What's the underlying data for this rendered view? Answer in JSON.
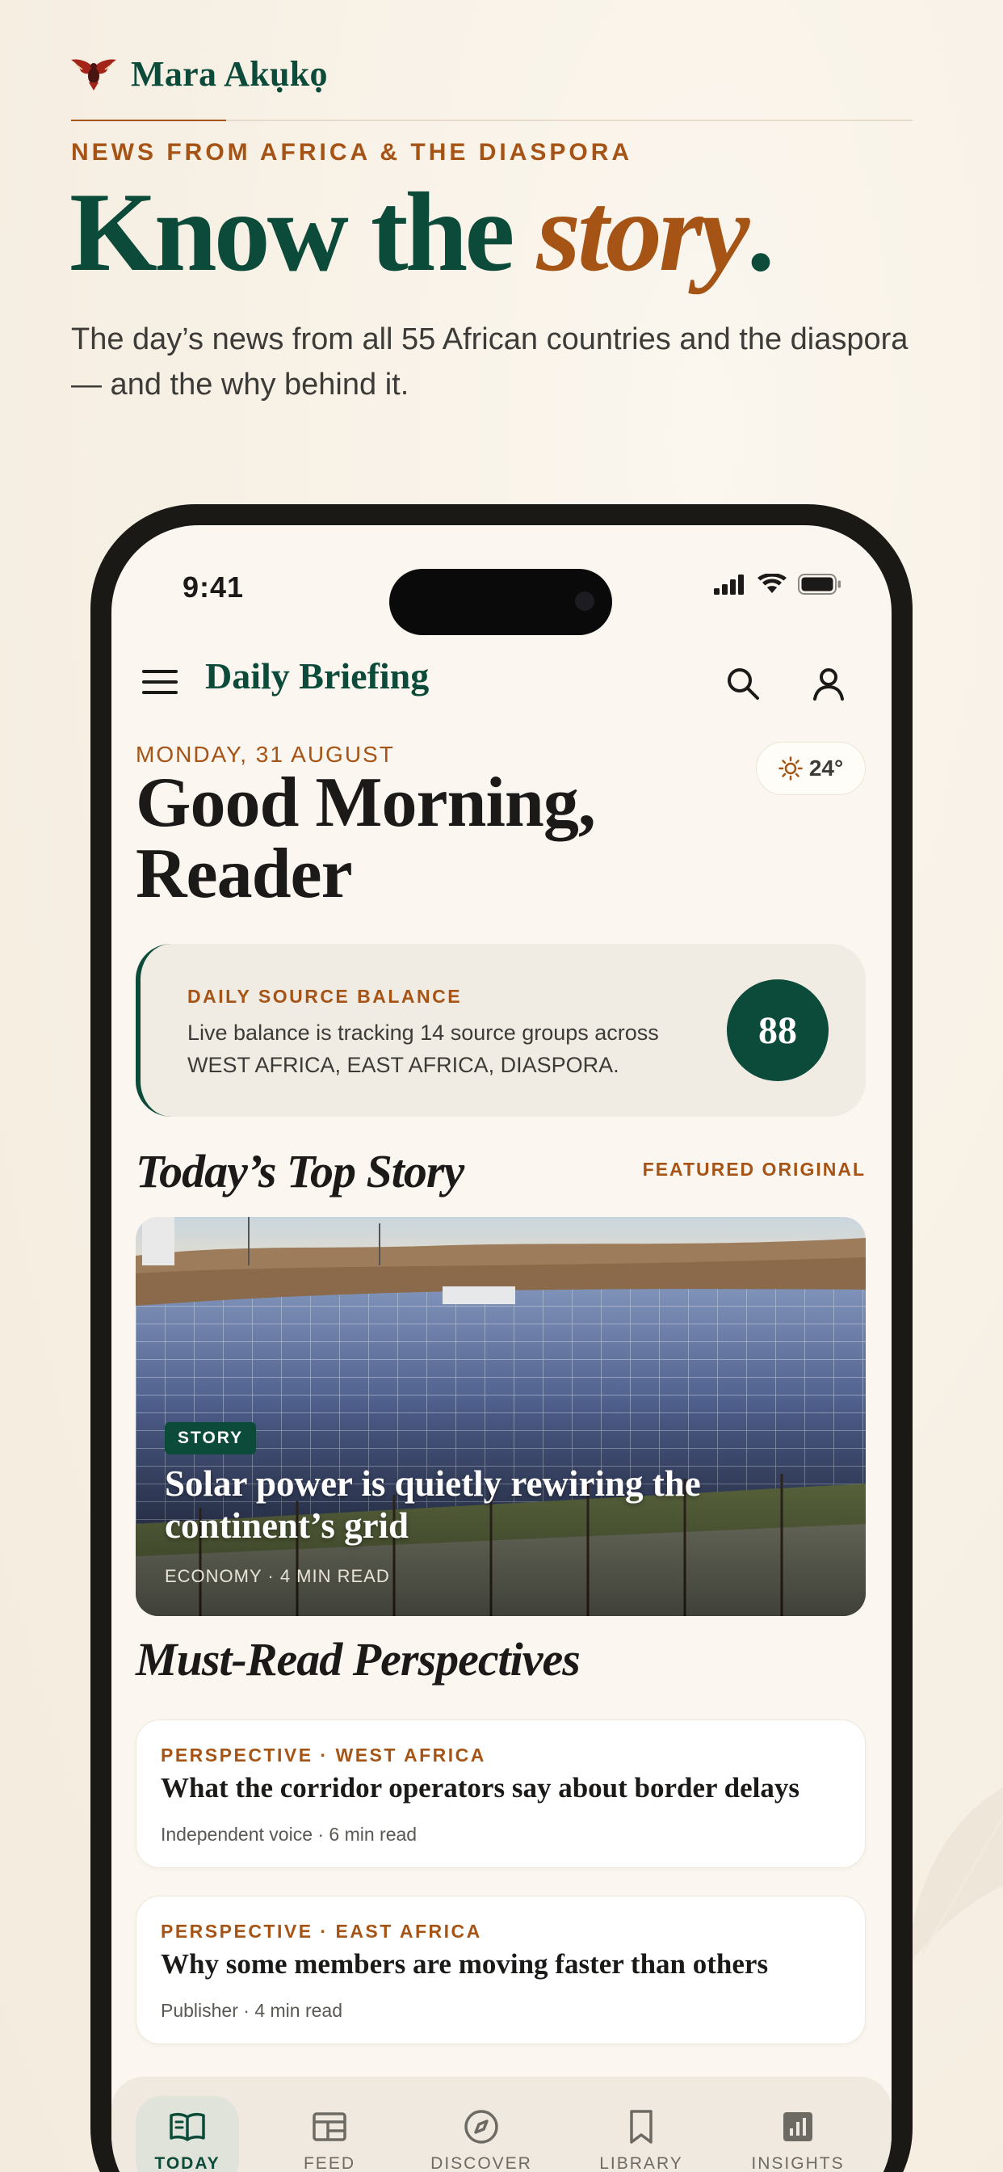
{
  "brand": {
    "name": "Mara Akụkọ",
    "logo_icon": "eagle-logo-icon"
  },
  "hero": {
    "kicker": "NEWS FROM AFRICA & THE DIASPORA",
    "headline_main": "Know the ",
    "headline_accent": "story",
    "headline_end": ".",
    "subhead": "The day’s news from all 55 African countries and the diaspora — and the why behind it."
  },
  "status_bar": {
    "time": "9:41",
    "icons": [
      "signal-icon",
      "wifi-icon",
      "battery-icon"
    ]
  },
  "app_bar": {
    "title": "Daily Briefing",
    "menu_icon": "hamburger-menu-icon",
    "search_icon": "search-icon",
    "profile_icon": "profile-icon"
  },
  "today": {
    "date": "MONDAY, 31 AUGUST",
    "greeting": "Good Morning, Reader",
    "weather": {
      "icon": "sun-icon",
      "temp": "24°"
    }
  },
  "balance": {
    "title": "DAILY SOURCE BALANCE",
    "text": "Live balance is tracking 14 source groups across WEST AFRICA, EAST AFRICA, DIASPORA.",
    "score": "88"
  },
  "top_story": {
    "section_title": "Today’s Top Story",
    "link": "FEATURED ORIGINAL",
    "badge": "STORY",
    "headline": "Solar power is quietly rewiring the continent’s grid",
    "meta": "ECONOMY · 4 MIN READ"
  },
  "perspectives": {
    "section_title": "Must-Read Perspectives",
    "items": [
      {
        "kicker": "PERSPECTIVE · WEST AFRICA",
        "title": "What the corridor operators say about border delays",
        "meta": "Independent voice · 6 min read"
      },
      {
        "kicker": "PERSPECTIVE · EAST AFRICA",
        "title": "Why some members are moving faster than others",
        "meta": "Publisher · 4 min read"
      }
    ]
  },
  "tabs": [
    {
      "label": "TODAY",
      "icon": "open-book-icon",
      "active": true
    },
    {
      "label": "FEED",
      "icon": "feed-icon",
      "active": false
    },
    {
      "label": "DISCOVER",
      "icon": "compass-icon",
      "active": false
    },
    {
      "label": "LIBRARY",
      "icon": "bookmark-icon",
      "active": false
    },
    {
      "label": "INSIGHTS",
      "icon": "bar-chart-icon",
      "active": false
    }
  ],
  "colors": {
    "brand_green": "#0c4a3a",
    "accent_rust": "#a65415",
    "background": "#f9f4ec"
  }
}
